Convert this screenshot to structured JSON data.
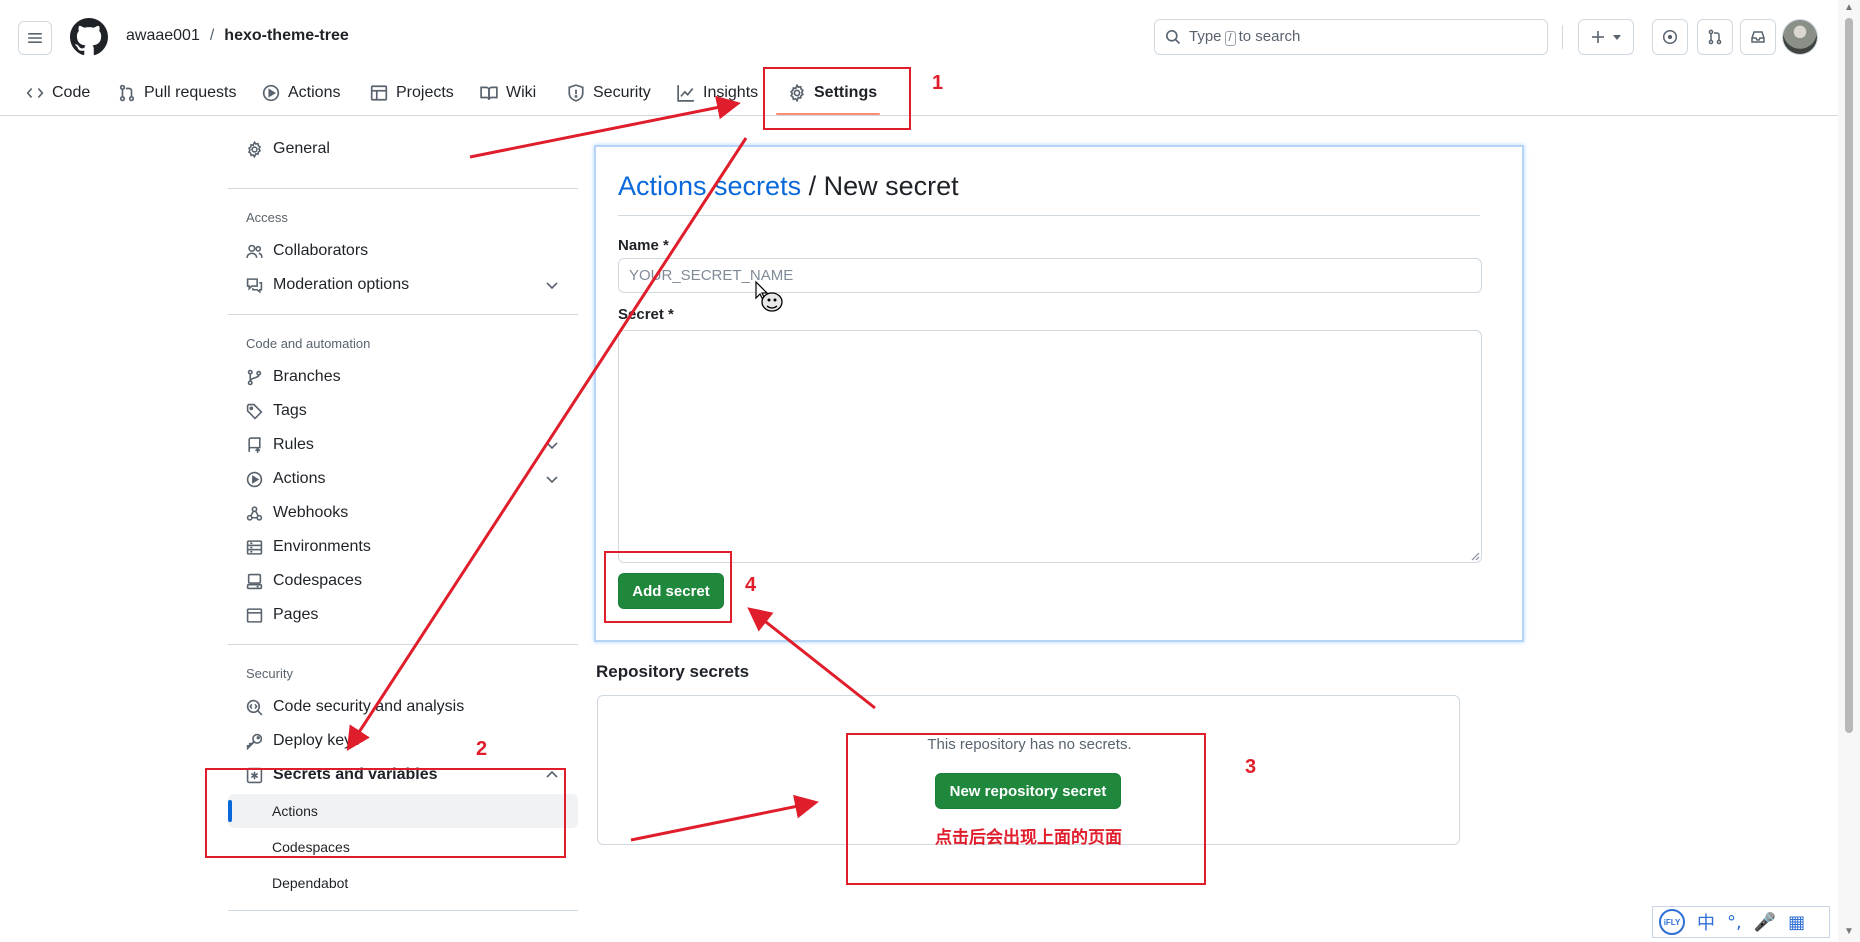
{
  "header": {
    "owner": "awaae001",
    "separator": "/",
    "repo": "hexo-theme-tree",
    "search_prefix": "Type",
    "search_key": "/",
    "search_suffix": "to search"
  },
  "nav": {
    "tabs": [
      {
        "label": "Code",
        "icon": "code-icon"
      },
      {
        "label": "Pull requests",
        "icon": "pull-request-icon"
      },
      {
        "label": "Actions",
        "icon": "play-icon"
      },
      {
        "label": "Projects",
        "icon": "table-icon"
      },
      {
        "label": "Wiki",
        "icon": "book-icon"
      },
      {
        "label": "Security",
        "icon": "shield-icon"
      },
      {
        "label": "Insights",
        "icon": "graph-icon"
      },
      {
        "label": "Settings",
        "icon": "gear-icon"
      }
    ]
  },
  "sidebar": {
    "general": "General",
    "access_heading": "Access",
    "collaborators": "Collaborators",
    "moderation": "Moderation options",
    "code_heading": "Code and automation",
    "branches": "Branches",
    "tags": "Tags",
    "rules": "Rules",
    "actions": "Actions",
    "webhooks": "Webhooks",
    "environments": "Environments",
    "codespaces": "Codespaces",
    "pages": "Pages",
    "security_heading": "Security",
    "code_security": "Code security and analysis",
    "deploy_keys": "Deploy keys",
    "secrets_variables": "Secrets and variables",
    "sub_actions": "Actions",
    "sub_codespaces": "Codespaces",
    "sub_dependabot": "Dependabot"
  },
  "form": {
    "title_link": "Actions secrets",
    "title_rest": " / New secret",
    "name_label": "Name *",
    "name_placeholder": "YOUR_SECRET_NAME",
    "secret_label": "Secret *",
    "add_button": "Add secret"
  },
  "repo_secrets": {
    "title": "Repository secrets",
    "empty_text": "This repository has no secrets.",
    "new_button": "New repository secret"
  },
  "annotations": {
    "n1": "1",
    "n2": "2",
    "n3": "3",
    "n4": "4",
    "note": "点击后会出现上面的页面",
    "color": "#e01e2b"
  },
  "ime": {
    "logo": "iFLY",
    "lang": "中",
    "punct": "°,",
    "mic": "🎤",
    "grid": "▦"
  },
  "colors": {
    "primary_button": "#1f883d",
    "link": "#0969da",
    "tab_underline": "#fd8c73",
    "active_bar": "#0969da"
  }
}
